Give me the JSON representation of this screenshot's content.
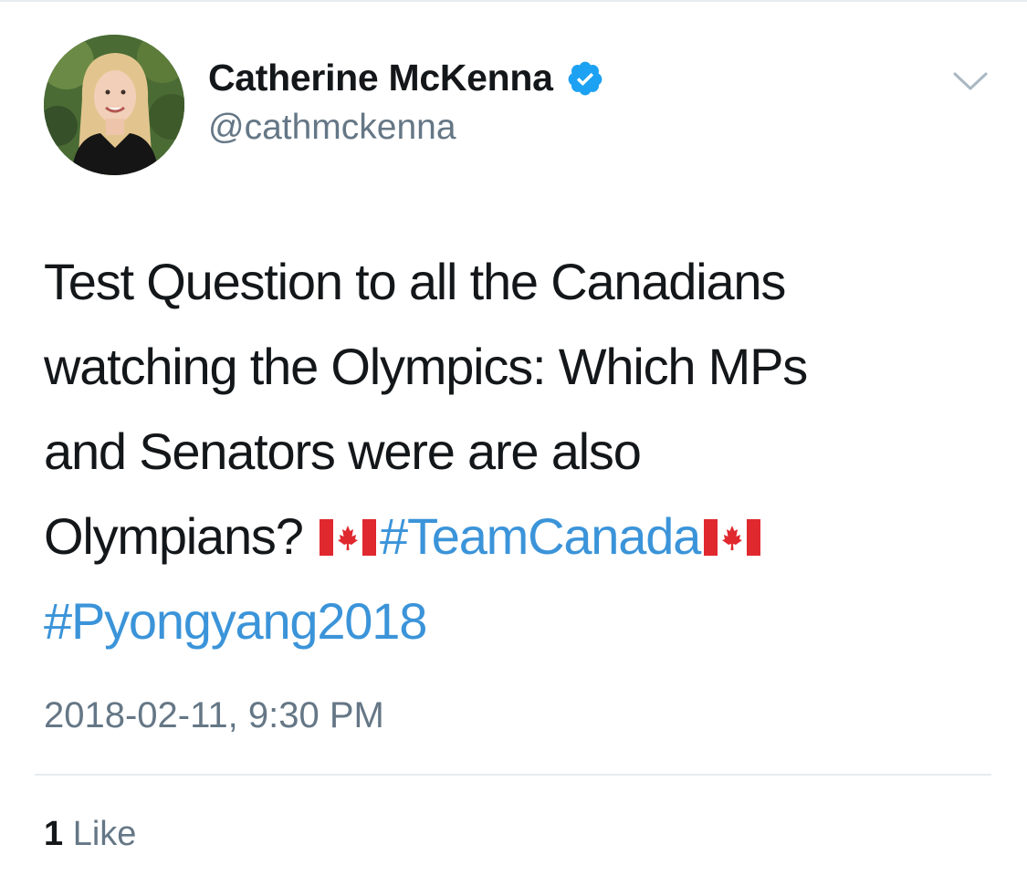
{
  "tweet": {
    "author": {
      "display_name": "Catherine McKenna",
      "handle": "@cathmckenna",
      "verified": true,
      "avatar": "profile-photo"
    },
    "text_lines": [
      "Test Question to all the Canadians",
      "watching the Olympics: Which MPs",
      "and Senators were are also"
    ],
    "text_tail": "Olympians?",
    "hashtags": [
      "#TeamCanada",
      "#Pyongyang2018"
    ],
    "timestamp": "2018-02-11, 9:30 PM",
    "likes": {
      "count": "1",
      "label": "Like"
    }
  },
  "icons": {
    "verified": "verified-badge-icon",
    "menu": "chevron-down-icon",
    "flag": "canada-flag-emoji"
  },
  "colors": {
    "link": "#3b94d9",
    "secondary": "#657786",
    "verified": "#1da1f2",
    "flag_red": "#e0282f"
  }
}
